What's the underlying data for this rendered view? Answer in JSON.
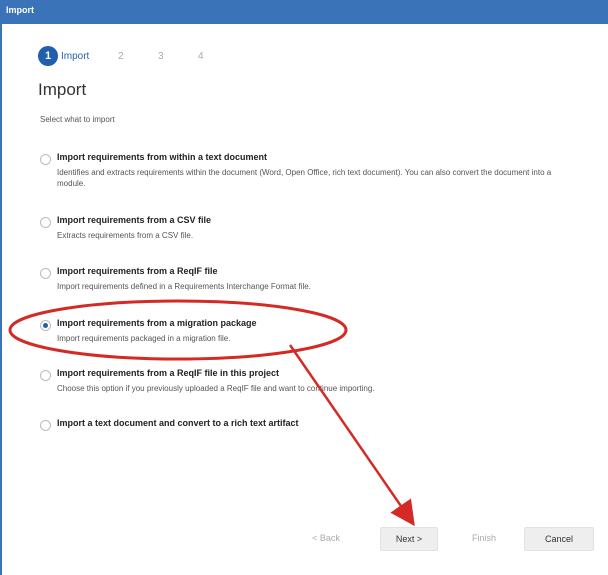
{
  "window": {
    "title": "Import"
  },
  "steps": [
    {
      "number": "1",
      "label": "Import"
    },
    {
      "number": "2",
      "label": ""
    },
    {
      "number": "3",
      "label": ""
    },
    {
      "number": "4",
      "label": ""
    }
  ],
  "page": {
    "title": "Import",
    "subtitle": "Select what to import"
  },
  "options": [
    {
      "title": "Import requirements from within a text document",
      "description": "Identifies and extracts requirements within the document (Word, Open Office, rich text document). You can also convert the document into a module.",
      "selected": false
    },
    {
      "title": "Import requirements from a CSV file",
      "description": "Extracts requirements from a CSV file.",
      "selected": false
    },
    {
      "title": "Import requirements from a ReqIF file",
      "description": "Import requirements defined in a Requirements Interchange Format file.",
      "selected": false
    },
    {
      "title": "Import requirements from a migration package",
      "description": "Import requirements packaged in a migration file.",
      "selected": true
    },
    {
      "title": "Import requirements from a ReqIF file in this project",
      "description": "Choose this option if you previously uploaded a ReqIF file and want to continue importing.",
      "selected": false
    },
    {
      "title": "Import a text document and convert to a rich text artifact",
      "description": "",
      "selected": false
    }
  ],
  "buttons": {
    "back": "< Back",
    "next": "Next >",
    "finish": "Finish",
    "cancel": "Cancel"
  },
  "colors": {
    "accent": "#1f5fae",
    "titlebar": "#3a73b8",
    "annotation": "#d42a25"
  }
}
